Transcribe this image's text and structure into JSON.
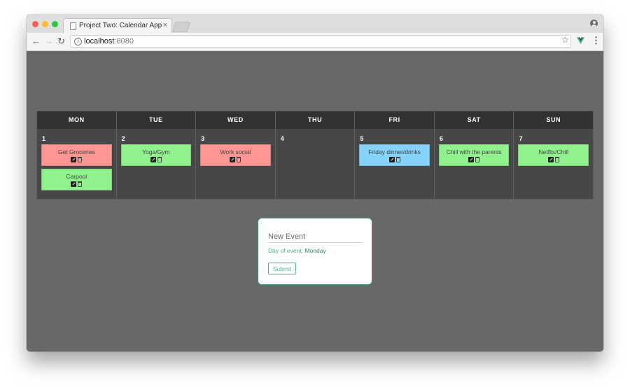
{
  "browser": {
    "tab_title": "Project Two: Calendar App",
    "tab_close": "×",
    "url_host": "localhost",
    "url_port": ":8080",
    "info_glyph": "i",
    "nav_back": "←",
    "nav_forward": "→",
    "nav_reload": "↻",
    "star_glyph": "☆",
    "menu_glyph": "⋮"
  },
  "calendar": {
    "days": [
      {
        "abbr": "MON",
        "num": "1",
        "events": [
          {
            "title": "Get Groceries",
            "color": "#ff9693"
          },
          {
            "title": "Carpool",
            "color": "#8ff28c"
          }
        ]
      },
      {
        "abbr": "TUE",
        "num": "2",
        "events": [
          {
            "title": "Yoga/Gym",
            "color": "#8ff28c"
          }
        ]
      },
      {
        "abbr": "WED",
        "num": "3",
        "events": [
          {
            "title": "Work social",
            "color": "#ff9693"
          }
        ]
      },
      {
        "abbr": "THU",
        "num": "4",
        "events": []
      },
      {
        "abbr": "FRI",
        "num": "5",
        "events": [
          {
            "title": "Friday dinner/drinks",
            "color": "#83d3fc"
          }
        ]
      },
      {
        "abbr": "SAT",
        "num": "6",
        "events": [
          {
            "title": "Chill with the parents",
            "color": "#8ff28c"
          }
        ]
      },
      {
        "abbr": "SUN",
        "num": "7",
        "events": [
          {
            "title": "Netflix/Chill",
            "color": "#8ff28c"
          }
        ]
      }
    ]
  },
  "new_event": {
    "placeholder": "New Event",
    "day_label": "Day of event:",
    "day_value": "Monday",
    "submit_label": "Submit"
  }
}
